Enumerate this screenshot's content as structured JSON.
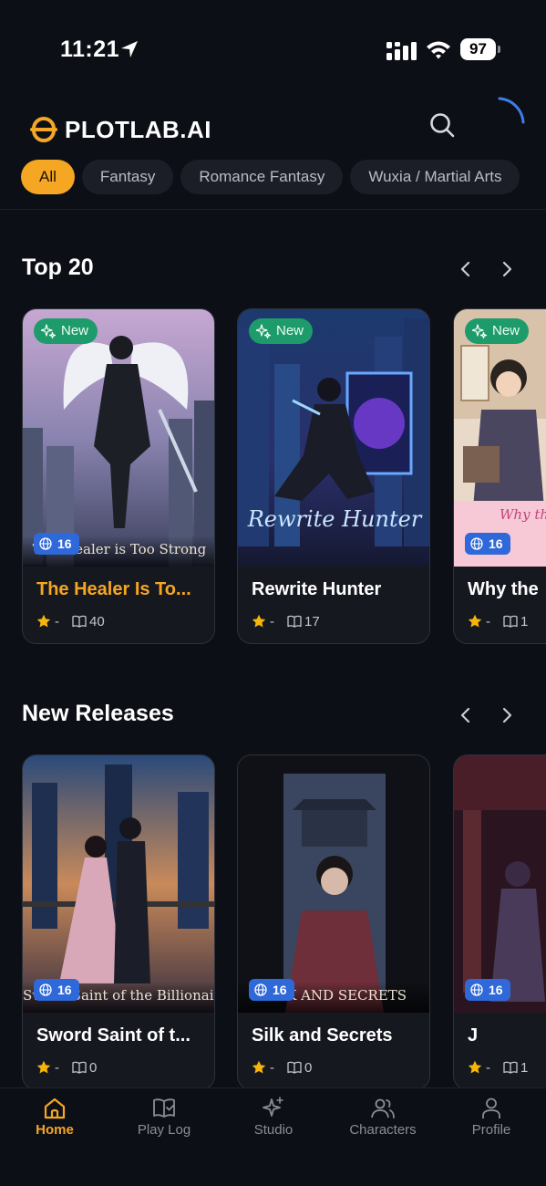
{
  "status": {
    "time": "11:21",
    "battery": "97"
  },
  "app": {
    "name": "PLOTLAB.AI",
    "brand_color": "#f5a623"
  },
  "chips": [
    "All",
    "Fantasy",
    "Romance Fantasy",
    "Wuxia / Martial Arts"
  ],
  "sections": {
    "top20": {
      "title": "Top 20",
      "cards": [
        {
          "title": "The Healer Is To...",
          "caption": "The Healer is Too Strong",
          "new_label": "New",
          "age": "16",
          "rating": "-",
          "chapters": "40"
        },
        {
          "title": "Rewrite Hunter",
          "caption": "Rewrite Hunter",
          "new_label": "New",
          "age": "16",
          "rating": "-",
          "chapters": "17"
        },
        {
          "title": "Why the",
          "caption": "Why the",
          "new_label": "New",
          "age": "16",
          "rating": "-",
          "chapters": "1"
        }
      ]
    },
    "new_releases": {
      "title": "New Releases",
      "cards": [
        {
          "title": "Sword Saint of t...",
          "caption": "Sword Saint of the Billionaire Family",
          "age": "16",
          "rating": "-",
          "chapters": "0"
        },
        {
          "title": "Silk and Secrets",
          "caption": "SILK AND SECRETS",
          "age": "16",
          "rating": "-",
          "chapters": "0"
        },
        {
          "title": "J",
          "caption": "",
          "age": "16",
          "rating": "-",
          "chapters": "1"
        }
      ]
    }
  },
  "nav": {
    "home": "Home",
    "play_log": "Play Log",
    "studio": "Studio",
    "characters": "Characters",
    "profile": "Profile"
  },
  "colors": {
    "new_badge": "#1e9b6a",
    "age_badge": "#2f68d8",
    "star": "#f5b50a"
  }
}
